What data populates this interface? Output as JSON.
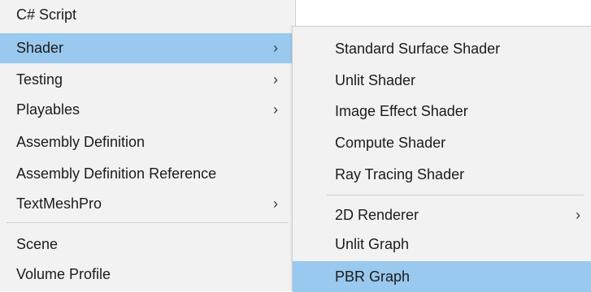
{
  "main_menu": {
    "items": [
      {
        "label": "C# Script"
      },
      {
        "label": "Shader",
        "arrow": "›"
      },
      {
        "label": "Testing",
        "arrow": "›"
      },
      {
        "label": "Playables",
        "arrow": "›"
      },
      {
        "label": "Assembly Definition"
      },
      {
        "label": "Assembly Definition Reference"
      },
      {
        "label": "TextMeshPro",
        "arrow": "›"
      },
      {
        "label": "Scene"
      },
      {
        "label": "Volume Profile"
      }
    ],
    "selected": "Shader"
  },
  "shader_submenu": {
    "items": [
      {
        "label": "Standard Surface Shader"
      },
      {
        "label": "Unlit Shader"
      },
      {
        "label": "Image Effect Shader"
      },
      {
        "label": "Compute Shader"
      },
      {
        "label": "Ray Tracing Shader"
      },
      {
        "label": "2D Renderer",
        "arrow": "›"
      },
      {
        "label": "Unlit Graph"
      },
      {
        "label": "PBR Graph"
      }
    ],
    "selected": "PBR Graph"
  },
  "colors": {
    "menu_bg": "#f2f2f2",
    "highlight": "#99c9ef",
    "separator": "#cfcfcf"
  }
}
